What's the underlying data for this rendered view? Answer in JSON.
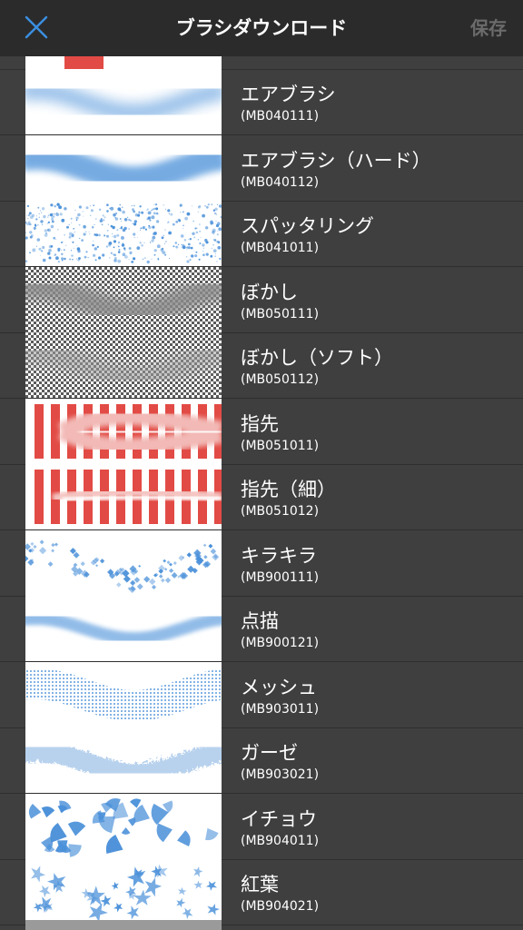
{
  "header": {
    "title": "ブラシダウンロード",
    "save_label": "保存"
  },
  "colors": {
    "brush": "#4a90d9",
    "red": "#e24b45",
    "bar": "#2b2b2b",
    "row_bg": "#3f3f3f"
  },
  "brushes": [
    {
      "name": "エアブラシ",
      "code": "(MB040111)",
      "preview": "airbrush"
    },
    {
      "name": "エアブラシ（ハード）",
      "code": "(MB040112)",
      "preview": "airbrush-hard"
    },
    {
      "name": "スパッタリング",
      "code": "(MB041011)",
      "preview": "spatter"
    },
    {
      "name": "ぼかし",
      "code": "(MB050111)",
      "preview": "blur"
    },
    {
      "name": "ぼかし（ソフト）",
      "code": "(MB050112)",
      "preview": "blur-soft"
    },
    {
      "name": "指先",
      "code": "(MB051011)",
      "preview": "finger"
    },
    {
      "name": "指先（細）",
      "code": "(MB051012)",
      "preview": "finger-fine"
    },
    {
      "name": "キラキラ",
      "code": "(MB900111)",
      "preview": "sparkle"
    },
    {
      "name": "点描",
      "code": "(MB900121)",
      "preview": "stipple"
    },
    {
      "name": "メッシュ",
      "code": "(MB903011)",
      "preview": "mesh"
    },
    {
      "name": "ガーゼ",
      "code": "(MB903021)",
      "preview": "gauze"
    },
    {
      "name": "イチョウ",
      "code": "(MB904011)",
      "preview": "ginkgo"
    },
    {
      "name": "紅葉",
      "code": "(MB904021)",
      "preview": "maple"
    }
  ]
}
